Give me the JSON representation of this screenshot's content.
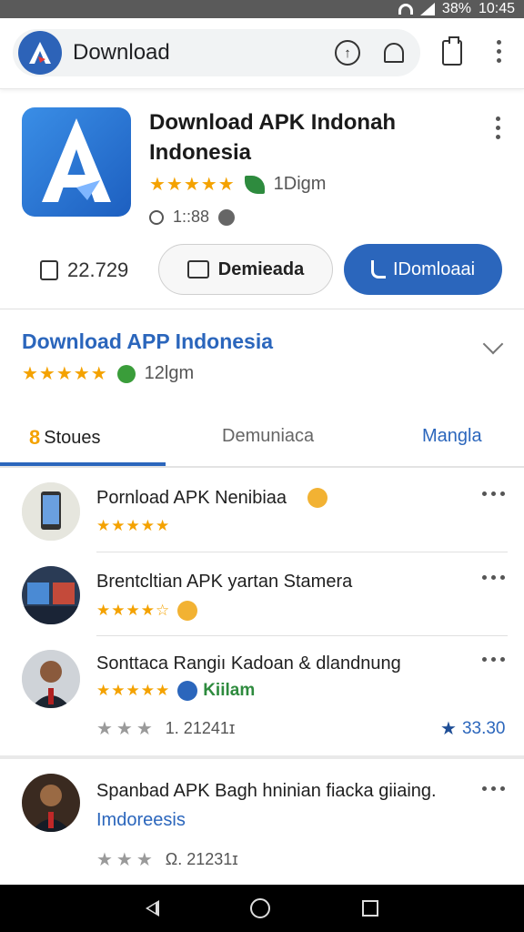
{
  "status_bar": {
    "battery": "38%",
    "time": "10:45"
  },
  "search": {
    "text": "Download"
  },
  "app": {
    "title": "Download APK Indonah Indonesia",
    "stars": "★★★★★",
    "reviews": "1Digm",
    "time": "1::88",
    "likes": "22.729",
    "secondary_button": "Demieada",
    "primary_button": "IDomloaai"
  },
  "section": {
    "title": "Download APP Indonesia",
    "stars": "★★★★★",
    "count": "12lgm"
  },
  "tabs": [
    {
      "num": "8",
      "label": "Stoues"
    },
    {
      "label": "Demuniaca"
    },
    {
      "label": "Mangla"
    }
  ],
  "items": [
    {
      "title": "Pornload APK Nenibiaa",
      "stars": "★★★★★"
    },
    {
      "title": "Brentcltian APK yartan Stamera",
      "stars": "★★★★☆"
    },
    {
      "title": "Sonttaca Rangiı Kadoan & dlandnung",
      "stars": "★★★★★",
      "badge": "Kiilam",
      "gray_stars": "★★★",
      "meta": "1. 21241ɪ",
      "rank": "33.30"
    },
    {
      "title": "Spanbad APK Bagh hninian fiacka giiaing.",
      "sub": "Imdoreesis",
      "gray_stars": "★★★",
      "meta": "Ω. 21231ɪ"
    }
  ]
}
